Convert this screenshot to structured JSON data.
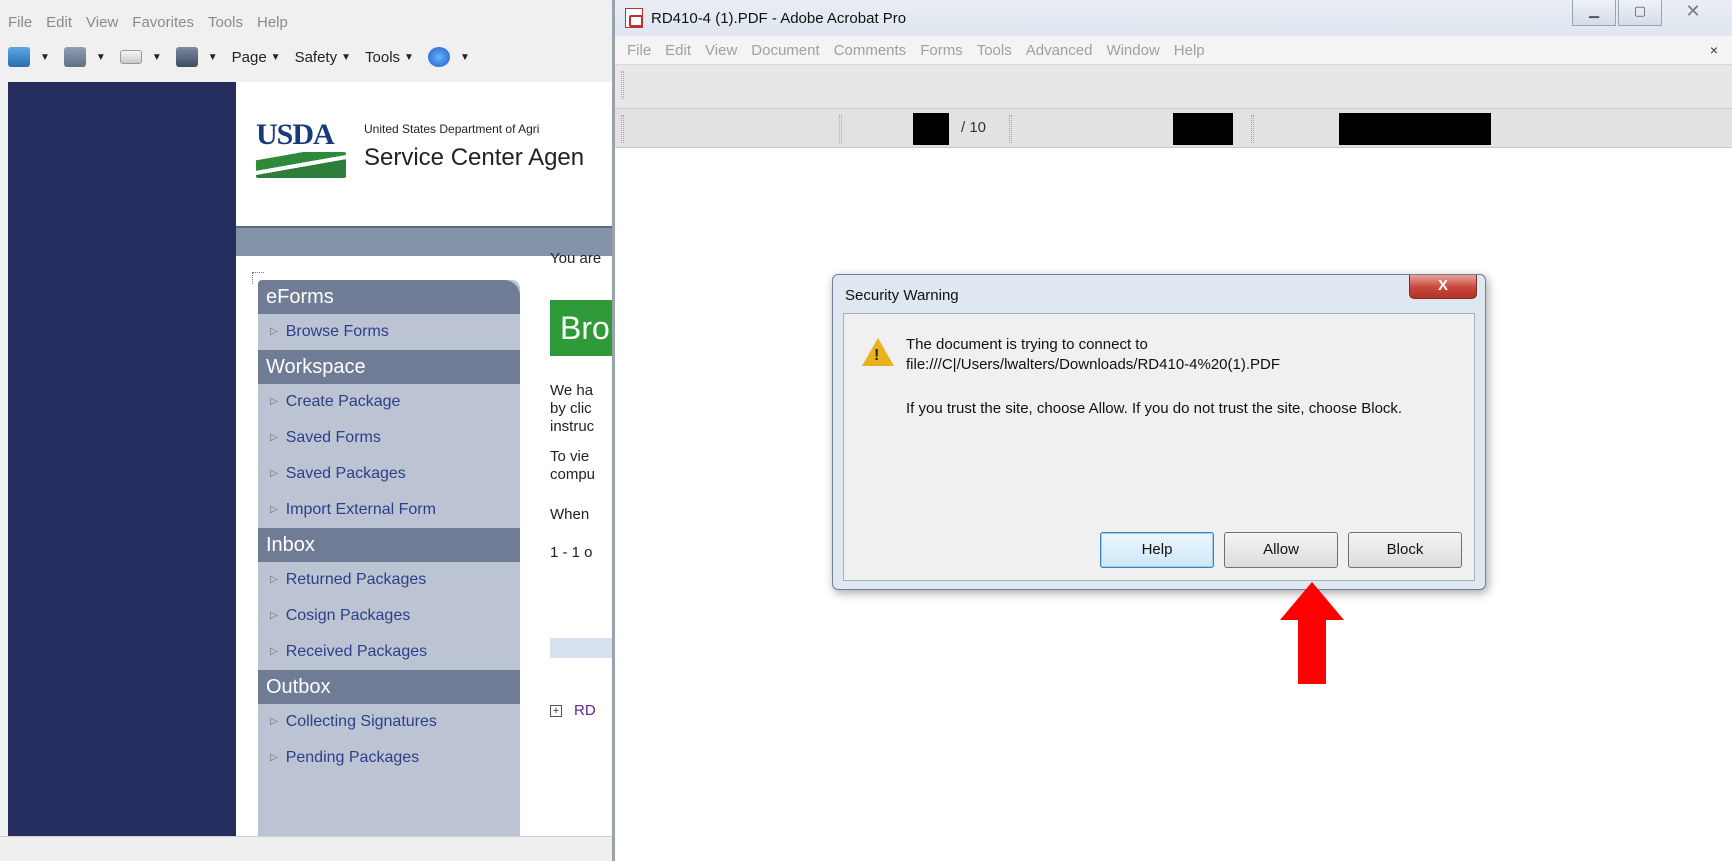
{
  "ie": {
    "menu": [
      "File",
      "Edit",
      "View",
      "Favorites",
      "Tools",
      "Help"
    ],
    "toolbar": {
      "page": "Page",
      "safety": "Safety",
      "tools": "Tools"
    },
    "header": {
      "department": "United States Department of Agri",
      "agency": "Service Center Agen",
      "logo": "USDA"
    },
    "sidebar": {
      "sections": [
        {
          "title": "eForms",
          "items": [
            "Browse Forms"
          ]
        },
        {
          "title": "Workspace",
          "items": [
            "Create Package",
            "Saved Forms",
            "Saved Packages",
            "Import External Form"
          ]
        },
        {
          "title": "Inbox",
          "items": [
            "Returned Packages",
            "Cosign Packages",
            "Received Packages"
          ]
        },
        {
          "title": "Outbox",
          "items": [
            "Collecting Signatures",
            "Pending Packages"
          ]
        }
      ]
    },
    "content": {
      "you_are": "You are",
      "heading": "Bro",
      "para1": [
        "We ha",
        "by clic",
        "instruc"
      ],
      "para2": [
        "To vie",
        "compu"
      ],
      "when": "When",
      "pager": "1 - 1 o",
      "link": "RD"
    }
  },
  "acrobat": {
    "title": "RD410-4 (1).PDF - Adobe Acrobat Pro",
    "menu": [
      "File",
      "Edit",
      "View",
      "Document",
      "Comments",
      "Forms",
      "Tools",
      "Advanced",
      "Window",
      "Help"
    ],
    "close_doc": "×",
    "page_total": "/ 10",
    "win_close": "✕"
  },
  "dialog": {
    "title": "Security Warning",
    "close": "X",
    "line1": "The document is trying to connect to",
    "line2": "file:///C|/Users/lwalters/Downloads/RD410-4%20(1).PDF",
    "line3": "If you trust the site, choose Allow. If you do not trust the site, choose Block.",
    "buttons": {
      "help": "Help",
      "allow": "Allow",
      "block": "Block"
    }
  },
  "colors": {
    "desktop": "#1f4a86",
    "annotation_arrow": "#ff0000",
    "usda_green": "#2e9a38"
  }
}
